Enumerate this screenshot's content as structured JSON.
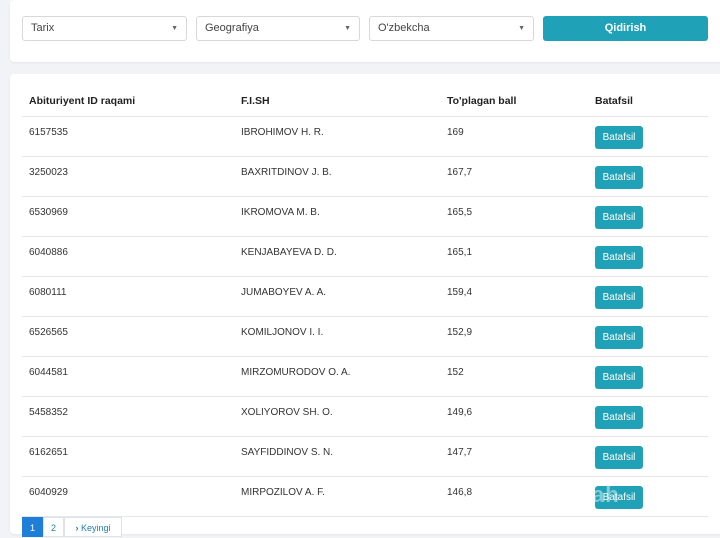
{
  "filters": {
    "subject1": "Tarix",
    "subject2": "Geografiya",
    "language": "O'zbekcha",
    "search_label": "Qidirish"
  },
  "table": {
    "headers": [
      "Abituriyent ID raqami",
      "F.I.SH",
      "To'plagan ball",
      "Batafsil"
    ],
    "rows": [
      {
        "id": "6157535",
        "name": "IBROHIMOV H. R.",
        "score": "169",
        "action": "Batafsil"
      },
      {
        "id": "3250023",
        "name": "BAXRITDINOV J. B.",
        "score": "167,7",
        "action": "Batafsil"
      },
      {
        "id": "6530969",
        "name": "IKROMOVA M. B.",
        "score": "165,5",
        "action": "Batafsil"
      },
      {
        "id": "6040886",
        "name": "KENJABAYEVA D. D.",
        "score": "165,1",
        "action": "Batafsil"
      },
      {
        "id": "6080111",
        "name": "JUMABOYEV A. A.",
        "score": "159,4",
        "action": "Batafsil"
      },
      {
        "id": "6526565",
        "name": "KOMILJONOV I. I.",
        "score": "152,9",
        "action": "Batafsil"
      },
      {
        "id": "6044581",
        "name": "MIRZOMURODOV O. A.",
        "score": "152",
        "action": "Batafsil"
      },
      {
        "id": "5458352",
        "name": "XOLIYOROV SH. O.",
        "score": "149,6",
        "action": "Batafsil"
      },
      {
        "id": "6162651",
        "name": "SAYFIDDINOV S. N.",
        "score": "147,7",
        "action": "Batafsil"
      },
      {
        "id": "6040929",
        "name": "MIRPOZILOV A. F.",
        "score": "146,8",
        "action": "Batafsil"
      }
    ]
  },
  "pagination": {
    "pages": [
      "1",
      "2"
    ],
    "active": "1",
    "next_label": "Keyingi"
  },
  "watermark": "ah",
  "colors": {
    "accent": "#1fa2b8",
    "page_active": "#1f7fd8"
  },
  "icons": {
    "select_caret": "caret-down-icon",
    "next": "chevron-right-icon"
  }
}
